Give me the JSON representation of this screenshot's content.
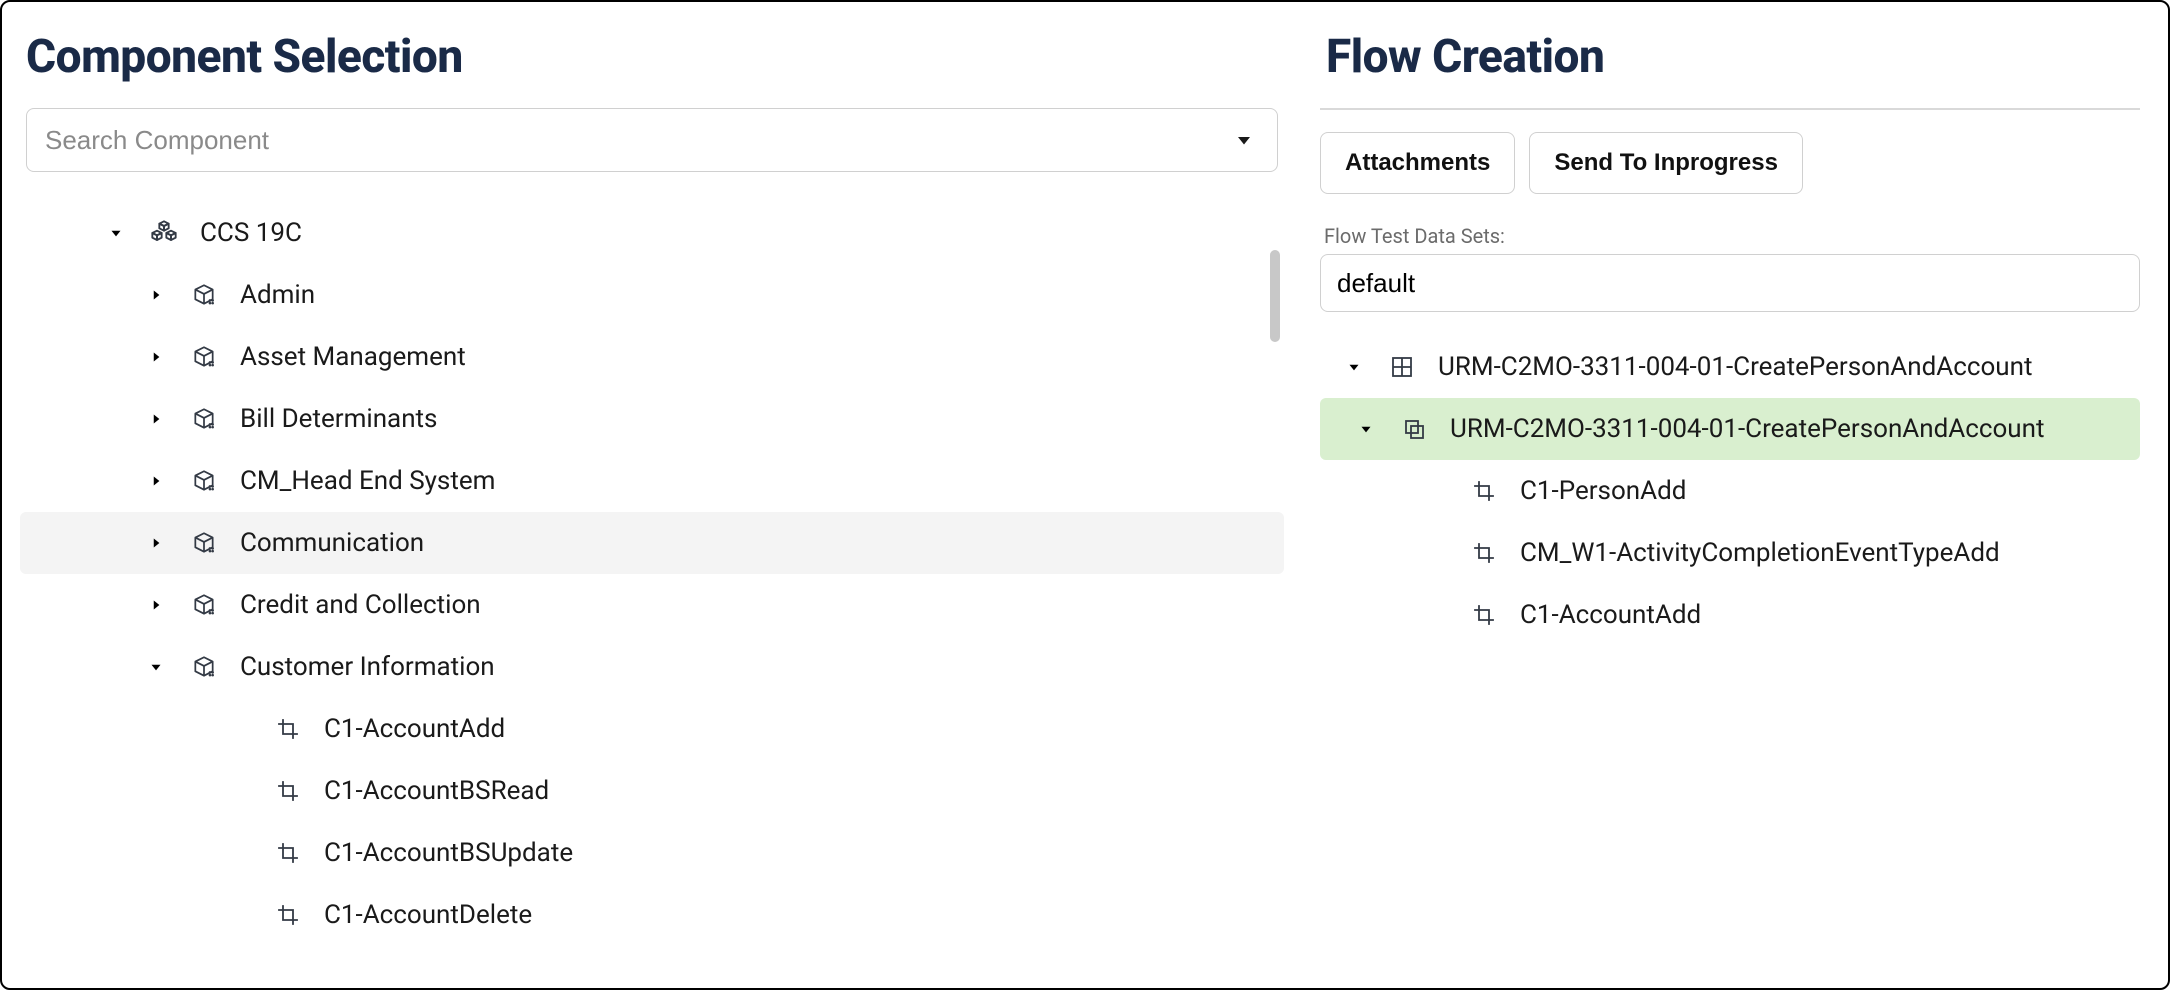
{
  "componentSelection": {
    "title": "Component Selection",
    "search_placeholder": "Search Component",
    "tree": {
      "root": {
        "label": "CCS 19C"
      },
      "children": [
        {
          "label": "Admin"
        },
        {
          "label": "Asset Management"
        },
        {
          "label": "Bill Determinants"
        },
        {
          "label": "CM_Head End System"
        },
        {
          "label": "Communication"
        },
        {
          "label": "Credit and Collection"
        },
        {
          "label": "Customer Information",
          "children": [
            {
              "label": "C1-AccountAdd"
            },
            {
              "label": "C1-AccountBSRead"
            },
            {
              "label": "C1-AccountBSUpdate"
            },
            {
              "label": "C1-AccountDelete"
            }
          ]
        }
      ]
    }
  },
  "flowCreation": {
    "title": "Flow Creation",
    "buttons": {
      "attachments": "Attachments",
      "send_to_inprogress": "Send To Inprogress"
    },
    "dataset_label": "Flow Test Data Sets:",
    "dataset_value": "default",
    "tree": {
      "root": {
        "label": "URM-C2MO-3311-004-01-CreatePersonAndAccount"
      },
      "scenario": {
        "label": "URM-C2MO-3311-004-01-CreatePersonAndAccount"
      },
      "steps": [
        {
          "label": "C1-PersonAdd"
        },
        {
          "label": "CM_W1-ActivityCompletionEventTypeAdd"
        },
        {
          "label": "C1-AccountAdd"
        }
      ]
    }
  }
}
